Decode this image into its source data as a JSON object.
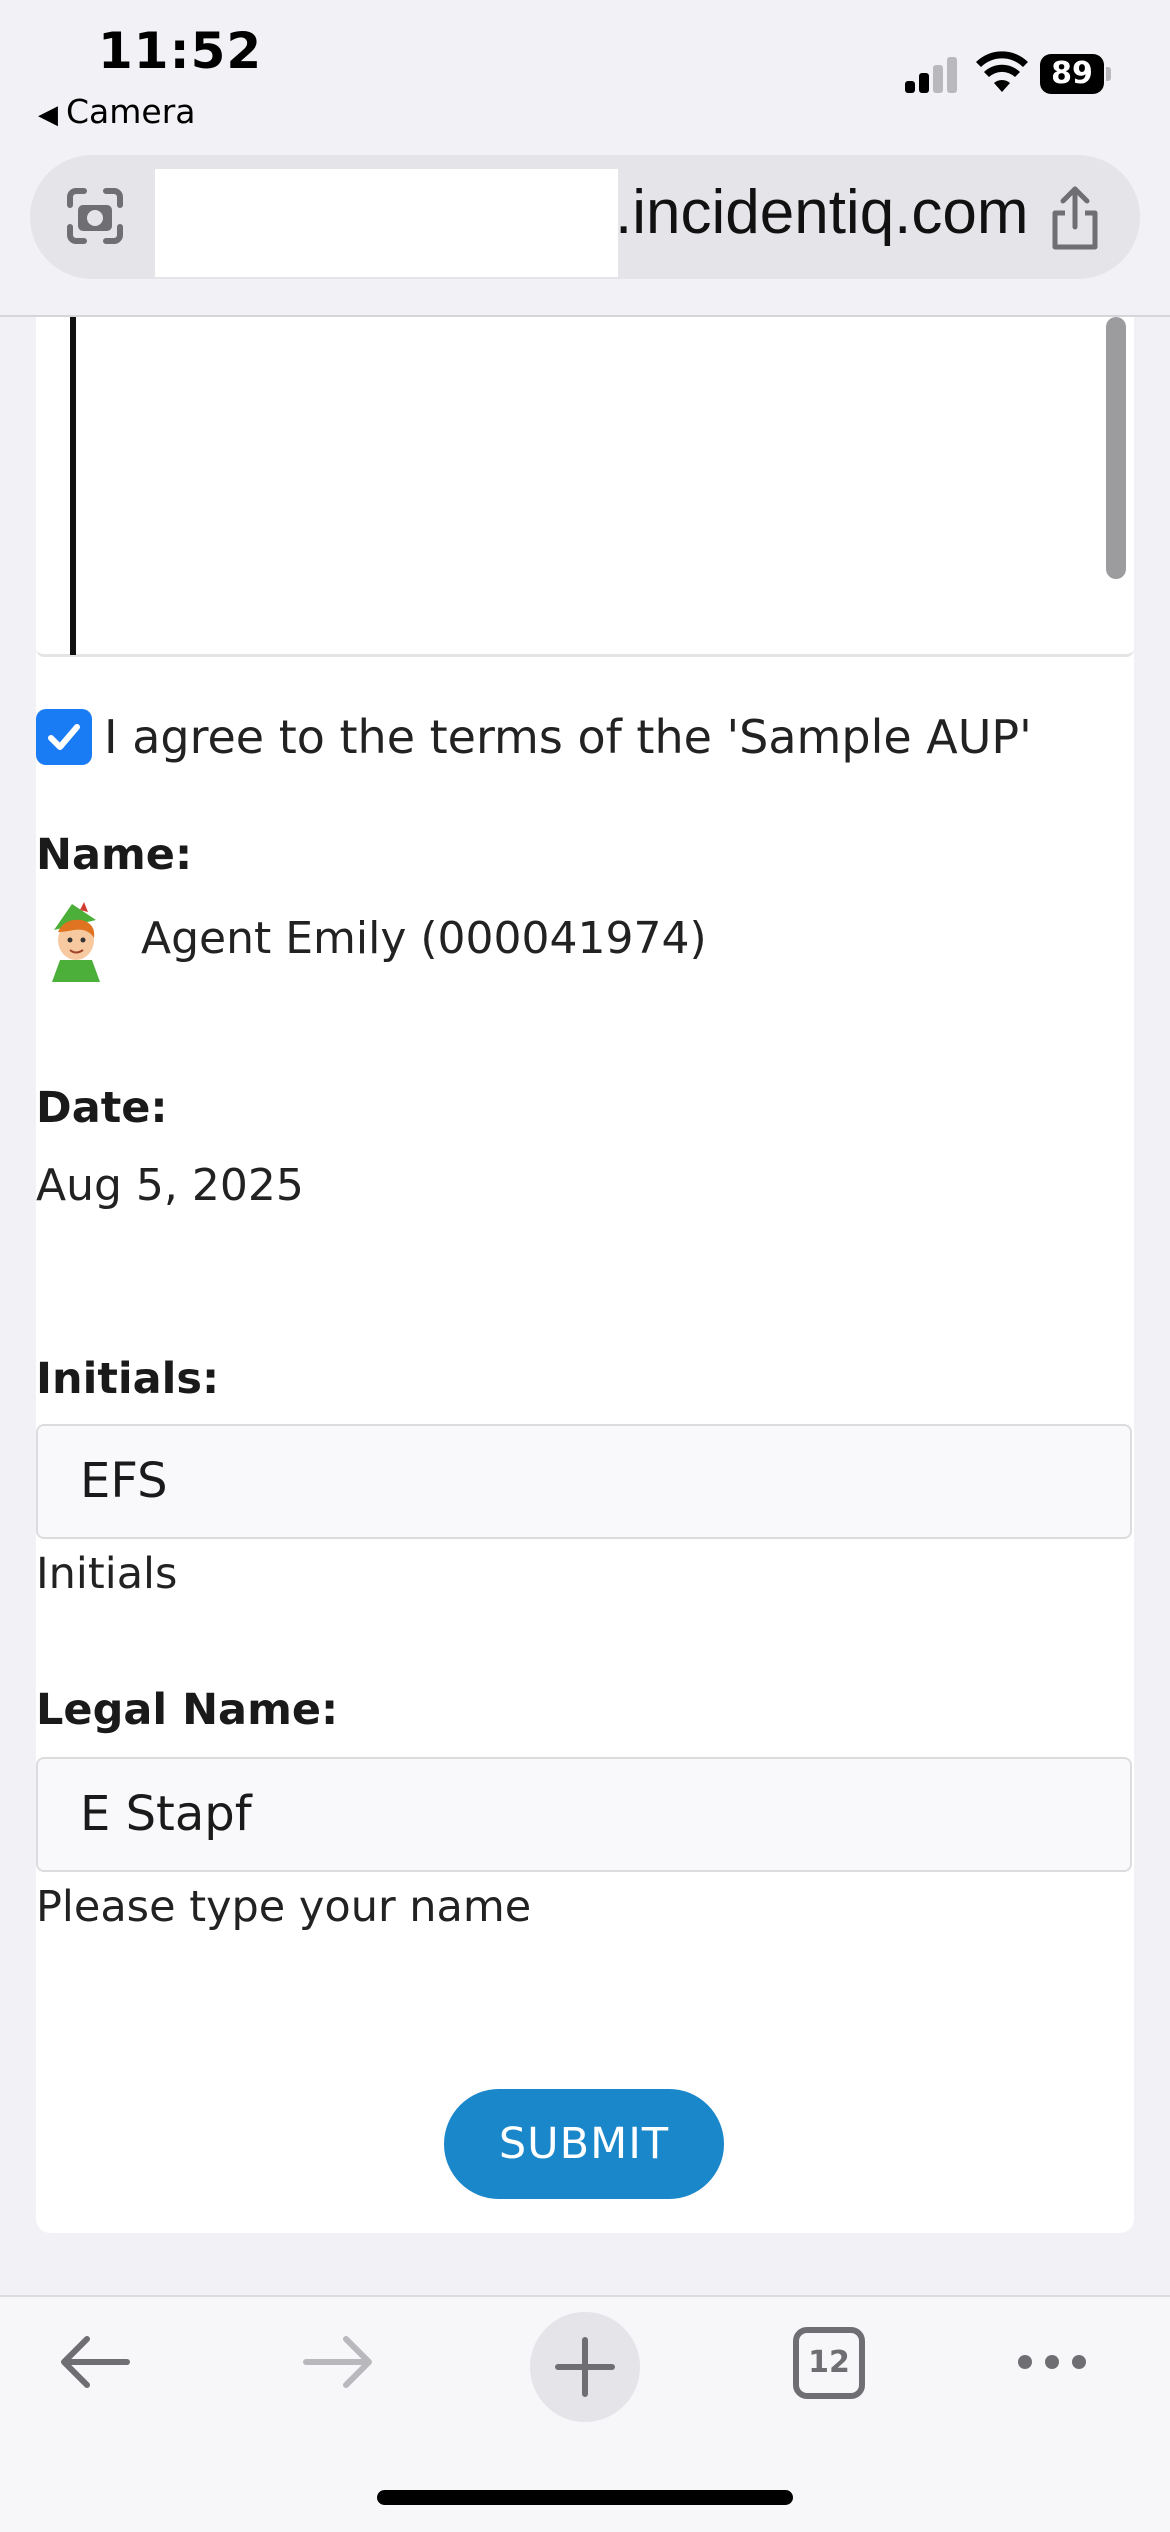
{
  "status_bar": {
    "time": "11:52",
    "back_app": "Camera",
    "battery_level": "89"
  },
  "browser": {
    "url_visible": ".incidentiq.com",
    "open_tabs_count": "12"
  },
  "form": {
    "agree_checkbox": {
      "checked": true,
      "label": "I agree to the terms of the 'Sample AUP'"
    },
    "name": {
      "label": "Name:",
      "value": "Agent Emily (000041974)"
    },
    "date": {
      "label": "Date:",
      "value": "Aug 5, 2025"
    },
    "initials": {
      "label": "Initials:",
      "value": "EFS",
      "helper": "Initials"
    },
    "legal_name": {
      "label": "Legal Name:",
      "value": "E Stapf",
      "helper": "Please type your name"
    },
    "submit_label": "SUBMIT"
  },
  "colors": {
    "checkbox": "#1a7cf5",
    "submit_button": "#1b87cb",
    "page_background": "#f2f2f6"
  }
}
